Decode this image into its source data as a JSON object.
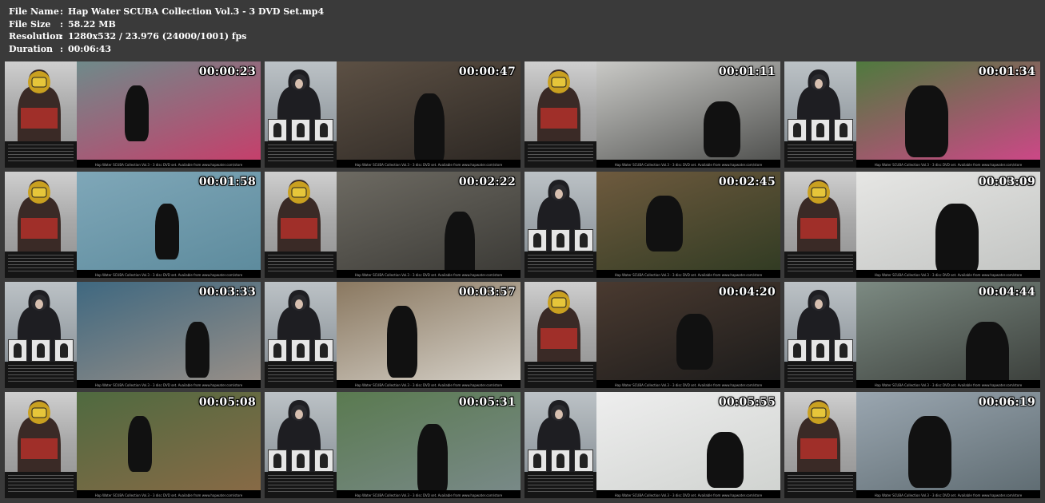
{
  "info": {
    "rows": [
      {
        "key": "File Name",
        "value": "Hap Water SCUBA Collection Vol.3 - 3 DVD Set.mp4"
      },
      {
        "key": "File Size",
        "value": "58.22 MB"
      },
      {
        "key": "Resolution",
        "value": "1280x532 / 23.976 (24000/1001) fps"
      },
      {
        "key": "Duration",
        "value": "00:06:43"
      }
    ]
  },
  "caption_text": "Hap Water SCUBA Collection Vol.3 - 3 disc DVD set. Available from www.hapwater.com/store",
  "thumbnails": [
    {
      "time": "00:00:23",
      "panel": "helmet",
      "scene": "#6f8a8a",
      "scene2": "#c93c6a"
    },
    {
      "time": "00:00:47",
      "panel": "drysuit",
      "scene": "#5c5044",
      "scene2": "#2b2622"
    },
    {
      "time": "00:01:11",
      "panel": "helmet",
      "scene": "#c9c9c6",
      "scene2": "#4c4d4b"
    },
    {
      "time": "00:01:34",
      "panel": "drysuit",
      "scene": "#4f7a3e",
      "scene2": "#d2458a"
    },
    {
      "time": "00:01:58",
      "panel": "helmet",
      "scene": "#7fa7b8",
      "scene2": "#5c8a9c"
    },
    {
      "time": "00:02:22",
      "panel": "helmet",
      "scene": "#6d6a62",
      "scene2": "#3a3935"
    },
    {
      "time": "00:02:45",
      "panel": "drysuit",
      "scene": "#6e5a3e",
      "scene2": "#2f3a22"
    },
    {
      "time": "00:03:09",
      "panel": "helmet",
      "scene": "#e6e6e4",
      "scene2": "#c2c4c2"
    },
    {
      "time": "00:03:33",
      "panel": "drysuit",
      "scene": "#3f6880",
      "scene2": "#9a9088"
    },
    {
      "time": "00:03:57",
      "panel": "drysuit",
      "scene": "#8a7860",
      "scene2": "#d8d4cc"
    },
    {
      "time": "00:04:20",
      "panel": "helmet",
      "scene": "#4a3a30",
      "scene2": "#1a1a1a"
    },
    {
      "time": "00:04:44",
      "panel": "drysuit",
      "scene": "#7c8a82",
      "scene2": "#3a3e3a"
    },
    {
      "time": "00:05:08",
      "panel": "helmet",
      "scene": "#4f6a40",
      "scene2": "#8a6a46"
    },
    {
      "time": "00:05:31",
      "panel": "drysuit",
      "scene": "#5a7a50",
      "scene2": "#7a8a8a"
    },
    {
      "time": "00:05:55",
      "panel": "drysuit",
      "scene": "#eeeeee",
      "scene2": "#cfd2cf"
    },
    {
      "time": "00:06:19",
      "panel": "helmet",
      "scene": "#9aa6b0",
      "scene2": "#5d6a70"
    }
  ]
}
